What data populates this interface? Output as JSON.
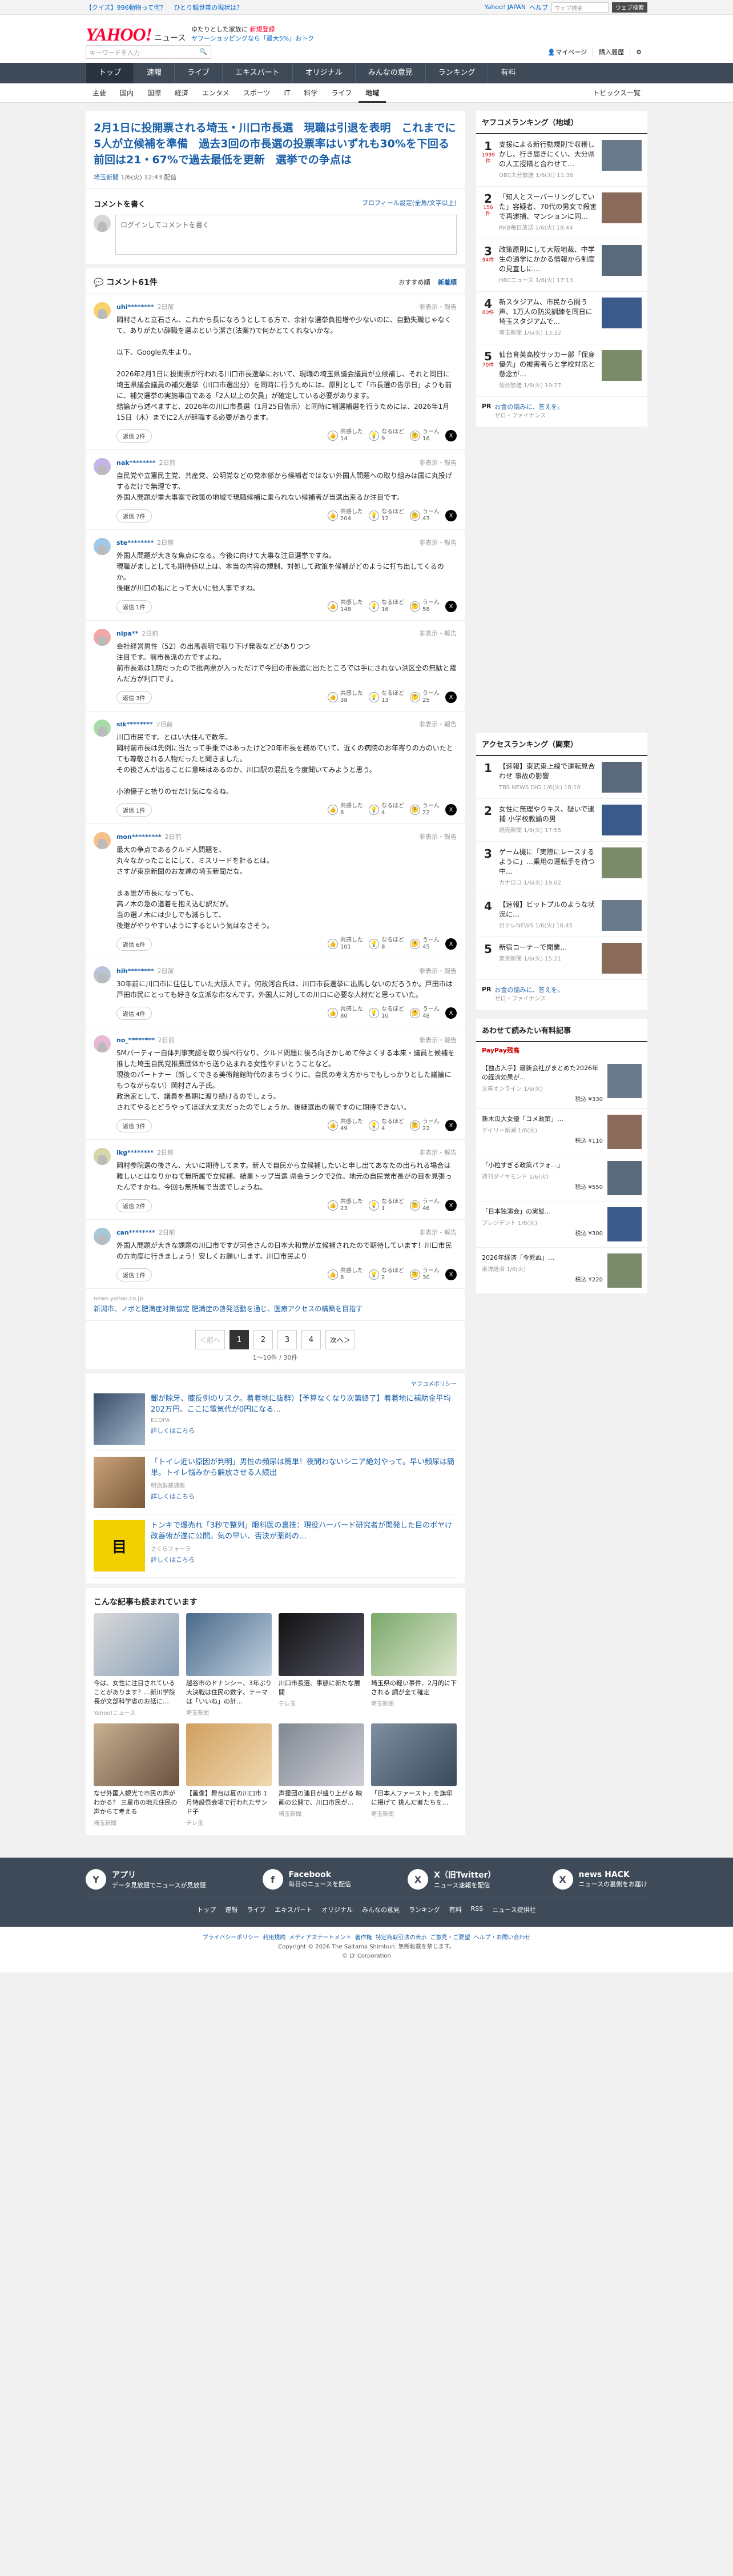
{
  "topbar": {
    "links": [
      "【クイズ】996動物って何？",
      "ひとり親世帯の現状は？"
    ],
    "right_links": [
      "Yahoo! JAPAN",
      "ヘルプ"
    ],
    "search_placeholder": "ウェブ検索",
    "search_button": "ウェブ検索"
  },
  "header": {
    "logo": "YAHOO!",
    "logo_sub": "ニュース",
    "promo_line1": "ゆたりとした家族に",
    "promo_line1b": "新規登録",
    "promo_line2": "ヤフーショッピングなら「最大5%」おトク",
    "search_placeholder": "キーワードを入力",
    "links": [
      "マイページ",
      "購入履歴"
    ]
  },
  "nav": [
    "トップ",
    "速報",
    "ライブ",
    "エキスパート",
    "オリジナル",
    "みんなの意見",
    "ランキング",
    "有料"
  ],
  "subnav": [
    "主要",
    "国内",
    "国際",
    "経済",
    "エンタメ",
    "スポーツ",
    "IT",
    "科学",
    "ライフ",
    "地域"
  ],
  "subnav_right": "トピックス一覧",
  "article": {
    "title": "2月1日に投開票される埼玉・川口市長選　現職は引退を表明　これまでに5人が立候補を準備　過去3回の市長選の投票率はいずれも30%を下回る　前回は21・67%で過去最低を更新　選挙での争点は",
    "source": "埼玉新聞",
    "date": "1/6(火) 12:43",
    "rep": "配信"
  },
  "comment_write": {
    "title": "コメントを書く",
    "note": "プロフィール設定(全角/文字以上)",
    "placeholder": "ログインしてコメントを書く"
  },
  "comments_head": {
    "title": "コメント61件",
    "sort_options": [
      "おすすめ順",
      "新着順"
    ]
  },
  "comments": [
    {
      "user": "uhi********",
      "time": "2日前",
      "report": "非表示・報告",
      "text": "岡村さんと立石さん、これから長になろうとしてる方で、余計な選挙負担増や少ないのに、自動失職じゃなくて、ありがたい辞職を選ぶという潔さ(法案?)で何かとてくれないかな。\n\n以下、Google先生より。\n\n2026年2月1日に投開票が行われる川口市長選挙において、現職の埼玉県議会議員が立候補し、それと同日に埼玉県議会議員の補欠選挙（川口市選出分）を同時に行うためには、原則として「市長選の告示日」よりも前に、補欠選挙の実施事由である「2人以上の欠員」が確定している必要があります。\n結論から述べますと、2026年の川口市長選（1月25日告示）と同時に補選補選を行うためには、2026年1月15日（木）までに2人が辞職する必要があります。",
      "reply": "返信 2件",
      "react": [
        "共感した",
        "なるほど",
        "うーん"
      ],
      "counts": [
        "14",
        "9",
        "16"
      ]
    },
    {
      "user": "nak********",
      "time": "2日前",
      "report": "非表示・報告",
      "text": "自民党や立憲民主党、共産党、公明党などの党本部から候補者ではない外国人問題への取り組みは国に丸投げするだけで無理です。\n外国人問題が重大事案で政策の地域で現職候補に乗られない候補者が当選出来るか注目です。",
      "reply": "返信 7件",
      "react": [
        "共感した",
        "なるほど",
        "うーん"
      ],
      "counts": [
        "204",
        "12",
        "43"
      ]
    },
    {
      "user": "ste********",
      "time": "2日前",
      "report": "非表示・報告",
      "text": "外国人問題が大きな焦点になる。今後に向けて大事な注目選挙ですね。\n現職がましとしても期待値以上は、本当の内容の規制、対処して政策を候補がどのように打ち出してくるのか。\n後継が川口の私にとって大いに他人事ですね。",
      "reply": "返信 1件",
      "react": [
        "共感した",
        "なるほど",
        "うーん"
      ],
      "counts": [
        "148",
        "16",
        "58"
      ]
    },
    {
      "user": "nipa**",
      "time": "2日前",
      "report": "非表示・報告",
      "text": "会社経営男性（52）の出馬表明で取り下げ発表などがありつつ\n注目です。前市長派の方ですよね。\n前市長派は1期だったので批判票が入っただけで今回の市長選に出たところでは手にされない洪区全の無駄と躍んだ方が利口です。",
      "reply": "返信 3件",
      "react": [
        "共感した",
        "なるほど",
        "うーん"
      ],
      "counts": [
        "38",
        "13",
        "25"
      ]
    },
    {
      "user": "sik********",
      "time": "2日前",
      "report": "非表示・報告",
      "text": "川口市民です。とはい大住んで数年。\n岡村前市長は先例に当たって手乗ではあったけど20年市長を務めていて、近くの病院のお年寄りの方のいたとても尊敬される人物だったと聞きました。\nその後さんが出ることに意味はあるのか、川口駅の混乱を今度聞いてみようと思う。\n\n小池優子と拾りのせだけ気になるね。",
      "reply": "返信 1件",
      "react": [
        "共感した",
        "なるほど",
        "うーん"
      ],
      "counts": [
        "8",
        "4",
        "22"
      ]
    },
    {
      "user": "mon*********",
      "time": "2日前",
      "report": "非表示・報告",
      "text": "最大の争点であるクルド人問題を、\n丸々なかったことにして、ミスリードを計るとは。\nさすが東京新聞のお友達の埼玉新聞だな。\n\nまぁ誰が市長になっても、\n高ノ木の急の道着を抱え込む訳だが。\n当の選ノ木には少しでも減らして、\n後継がやりやすいようにするという気はなさそう。",
      "reply": "返信 6件",
      "react": [
        "共感した",
        "なるほど",
        "うーん"
      ],
      "counts": [
        "101",
        "8",
        "45"
      ]
    },
    {
      "user": "hih********",
      "time": "2日前",
      "report": "非表示・報告",
      "text": "30年前に川口市に住住していた大阪人です。何故河合氏は、川口市長選挙に出馬しないのだろうか。戸田市は戸田市民にとっても好きな立派な市なんです。外国人に対しての川口に必要な人材だと思っていた。",
      "reply": "返信 4件",
      "react": [
        "共感した",
        "なるほど",
        "うーん"
      ],
      "counts": [
        "80",
        "10",
        "48"
      ]
    },
    {
      "user": "no_********",
      "time": "2日前",
      "report": "非表示・報告",
      "text": "SMパーティー自体判事実認を取り調べ行なり、クルド問題に後ろ向きかしめて仲よくする本来・議員と候補を推した埼玉自民党推薦団体から送り込まれる女性やすいとうことなど。\n現後のパートナー（新しくできる美術館館時代のまちづくりに、自民の考え方からでもしっかりとした議論にもつながらない）岡村さん子氏。\n政治家として、議員を長期に渡り続けるのでしょう。\nされてやるとどうやってほぼ大丈夫だったのでしょうか。後継選出の前ですのに期待できない。",
      "reply": "返信 3件",
      "react": [
        "共感した",
        "なるほど",
        "うーん"
      ],
      "counts": [
        "49",
        "4",
        "22"
      ]
    },
    {
      "user": "ikg********",
      "time": "2日前",
      "report": "非表示・報告",
      "text": "岡村参院選の後さん、大いに期待してます。新人で自民から立候補したいと申し出てあなたの出られる場合は難しいとはなりかねて無所属で立候補。結果トップ当選 県会ランクで2位。地元の自民党市長がの目を見張ったんですかね。今回も無所属で当選でしょうね。",
      "reply": "返信 2件",
      "react": [
        "共感した",
        "なるほど",
        "うーん"
      ],
      "counts": [
        "23",
        "1",
        "46"
      ]
    },
    {
      "user": "can********",
      "time": "2日前",
      "report": "非表示・報告",
      "text": "外国人問題が大きな課題の川口市ですが河合さんの日本大和党が立候補されたので期待しています！川口市民の方向度に行きましょう！安しくお願いします。川口市民より",
      "reply": "返信 1件",
      "react": [
        "共感した",
        "なるほど",
        "うーん"
      ],
      "counts": [
        "8",
        "2",
        "30"
      ]
    }
  ],
  "inline_ad": {
    "src": "news.yahoo.co.jp",
    "title": "新潟市、ノボと肥満症対策協定 肥満症の啓発活動を通じ、医療アクセスの構築を目指す"
  },
  "pager": {
    "prev": "＜前へ",
    "pages": [
      "1",
      "2",
      "3",
      "4"
    ],
    "next": "次へ＞",
    "count": "1〜10件 / 30件"
  },
  "ads_label": "ヤフコメポリシー",
  "ads": [
    {
      "text": "郵が除牙、膝反例のリスク。着着地に抜群）【予算なくなり次第終了】着着地に補助金平均202万円。ここに電気代が0円になる…",
      "sponsor": "ECOPA",
      "more": "詳しくはこちら"
    },
    {
      "text": "「トイレ近い原因が判明」男性の頻尿は簡単！夜間わないシニア絶対やって。早い頻尿は簡単。トイレ悩みから解放させる人続出",
      "sponsor": "明治製薬通販",
      "more": "詳しくはこちら"
    },
    {
      "text": "トンキで爆売れ「3秒で整列」眼科医の裏技：現役ハーバード研究者が開発した目のボヤけ改善術が遂に公開。気の早い、否決が薬剤の…",
      "sponsor": "さくらフォーラ",
      "more": "詳しくはこちら"
    }
  ],
  "also_read": {
    "title": "こんな記事も読まれています",
    "cards": [
      {
        "t": "今は、女性に注目されていることがあります？…新川学院長が文部科学省のお話に…",
        "d": "Yahoo!ニュース"
      },
      {
        "t": "越谷市のドナンシー、3年ぶり大決戦は住民の数字、テーマは「いいね」の計…",
        "d": "埼玉新聞"
      },
      {
        "t": "川口市長選、事態に新たな展開",
        "d": "テレ玉"
      },
      {
        "t": "埼玉県の軽い事件、2月的に下される 調が全て確定",
        "d": "埼玉新聞"
      },
      {
        "t": "なぜ外国人観光で市民の声がわかる？ 三星市の地元住民の声からて考える",
        "d": "埼玉新聞"
      },
      {
        "t": "【画像】舞台は夏の川口市 1月特設祭会場で行われたサンド子",
        "d": "テレ玉"
      },
      {
        "t": "声援団の連日が盛り上がる 映画の公開で、川口市民が…",
        "d": "埼玉新聞"
      },
      {
        "t": "「日本人ファースト」を旗印に掲げて 挑んだ者たちを…",
        "d": "埼玉新聞"
      }
    ]
  },
  "side_rank": {
    "title": "ヤフコメランキング（地域）",
    "items": [
      {
        "no": "1",
        "c": "1999件",
        "t": "支援による新行動規則で収穫しかし、行き届きにくい、大分県の人工授精と合わせて…",
        "m": "OBS大分放送 1/6(火) 11:36"
      },
      {
        "no": "2",
        "c": "156件",
        "t": "「知人とスーパーリングしていた」容疑者、70代の男女で殺害で再逮捕、マンションに同…",
        "m": "RKB毎日放送 1/6(火) 18:44"
      },
      {
        "no": "3",
        "c": "94件",
        "t": "政策原則にして大阪地裁、中学生の通学にかかる情報から制度の見直しに…",
        "m": "HBCニュース 1/6(火) 17:13"
      },
      {
        "no": "4",
        "c": "80件",
        "t": "新スタジアム、市民から問う声、1万人の防災訓練を同日に埼玉スタジアムで…",
        "m": "埼玉新聞 1/6(火) 13:32"
      },
      {
        "no": "5",
        "c": "70件",
        "t": "仙台育英高校サッカー部「保身優先」の被害者らと学校対応と懸念が…",
        "m": "仙台放送 1/6(火) 19:27"
      }
    ],
    "pr": {
      "tag": "PR",
      "t": "お金の悩みに、答えを。",
      "s": "ゼロ・ファイナンス"
    }
  },
  "side_access": {
    "title": "アクセスランキング（関東）",
    "items": [
      {
        "no": "1",
        "t": "【速報】東武東上線で運転見合わせ 事故の影響",
        "m": "TBS NEWS DIG 1/6(火) 18:10"
      },
      {
        "no": "2",
        "t": "女性に無理やりキス、疑いで逮捕 小学校教諭の男",
        "m": "読売新聞 1/6(火) 17:55"
      },
      {
        "no": "3",
        "t": "ゲーム機に「実際にレースするように」…乗用の運転手を待つ中…",
        "m": "カナロコ 1/6(火) 19:02"
      },
      {
        "no": "4",
        "t": "【速報】ビットプルのような状況に…",
        "m": "日テレNEWS 1/6(火) 16:45"
      },
      {
        "no": "5",
        "t": "新宿コーナーで開業…",
        "m": "東京新聞 1/6(火) 15:21"
      }
    ],
    "pr": {
      "tag": "PR",
      "t": "お金の悩みに、答えを。",
      "s": "ゼロ・ファイナンス"
    }
  },
  "side_shop": {
    "title": "あわせて読みたい有料記事",
    "brand": "PayPay残高",
    "items": [
      {
        "t": "【独占入手】最新会社がまとめた2026年の経済効果が…",
        "m": "文春オンライン 1/6(火)",
        "p": "税込 ¥330"
      },
      {
        "t": "新木瓜大女優「コメ政策」…",
        "m": "デイリー新潮 1/6(火)",
        "p": "税込 ¥110"
      },
      {
        "t": "「小粒すぎる政策パフォ…」",
        "m": "週刊ダイヤモンド 1/6(火)",
        "p": "税込 ¥550"
      },
      {
        "t": "「日本独演会」の実態…",
        "m": "プレジデント 1/6(火)",
        "p": "税込 ¥300"
      },
      {
        "t": "2026年経済「今死ぬ」…",
        "m": "東洋経済 1/6(火)",
        "p": "税込 ¥220"
      }
    ]
  },
  "footer": {
    "apps": [
      {
        "b": "アプリ",
        "s": "データ見放題でニュースが見放題",
        "icon": "Y"
      },
      {
        "b": "Facebook",
        "s": "毎日のニュースを配信",
        "icon": "f"
      },
      {
        "b": "X（旧Twitter）",
        "s": "ニュース速報を配信",
        "icon": "X"
      },
      {
        "b": "news HACK",
        "s": "ニュースの裏側をお届け",
        "icon": "X"
      }
    ],
    "cats": [
      "トップ",
      "速報",
      "ライブ",
      "エキスパート",
      "オリジナル",
      "みんなの意見",
      "ランキング",
      "有料",
      "RSS",
      "ニュース提供社"
    ]
  },
  "legal": {
    "links": [
      "プライバシーポリシー",
      "利用規約",
      "メディアステートメント",
      "著作権",
      "特定商取引法の表示",
      "ご意見・ご要望",
      "ヘルプ・お問い合わせ"
    ],
    "copy1": "Copyright © 2026 The Saitama Shimbun. 無断転載を禁じます。",
    "copy2": "© LY Corporation"
  },
  "colors": {
    "nav": "#3e4a58",
    "link": "#1a5fa8",
    "accent": "#ff0033"
  }
}
